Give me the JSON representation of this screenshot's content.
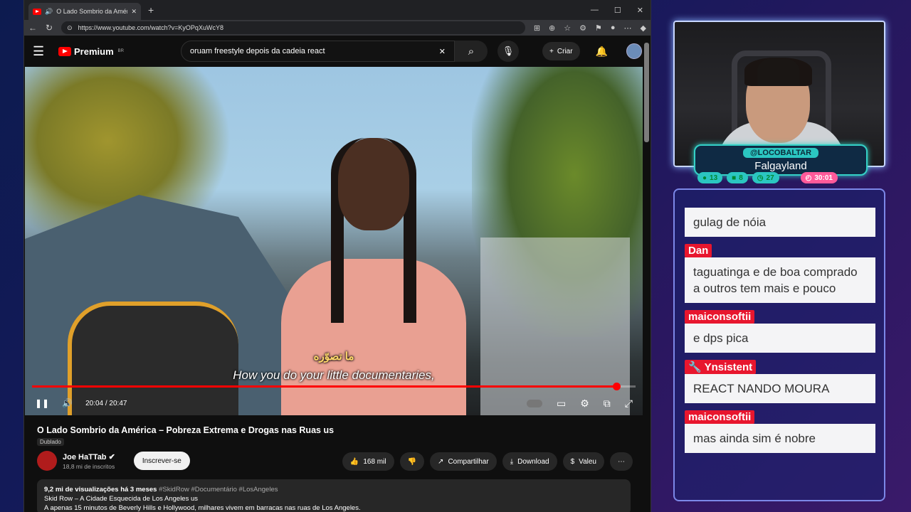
{
  "browser": {
    "tab_title": "O Lado Sombrio da Américа",
    "url": "https://www.youtube.com/watch?v=KyOPqXuWcY8",
    "win_min": "—",
    "win_max": "☐",
    "win_close": "✕"
  },
  "youtube": {
    "logo_text": "Premium",
    "logo_region": "BR",
    "search_query": "oruam freestyle depois da cadeia react",
    "create_label": "Criar",
    "video": {
      "subtitle_ar": "ما تصوّره",
      "subtitle_en": "How you do your little documentaries,",
      "time": "20:04 / 20:47",
      "progress": 0.968
    },
    "title": "O Lado Sombrio da América – Pobreza Extrema e Drogas nas Ruas us",
    "dubbed": "Dublado",
    "channel_name": "Joe HaTTab",
    "channel_subs": "18,8 mi de inscritos",
    "subscribe_label": "Inscrever-se",
    "likes": "168 mil",
    "share_label": "Compartilhar",
    "download_label": "Download",
    "thanks_label": "Valeu",
    "desc": {
      "views": "9,2 mi de visualizações",
      "age": "há 3 meses",
      "tags": "#SkidRow #Documentário #LosAngeles",
      "line1": "Skid Row – A Cidade Esquecida de Los Angeles us",
      "line2": "A apenas 15 minutos de Beverly Hills e Hollywood, milhares vivem em barracas nas ruas de Los Angeles."
    }
  },
  "overlay": {
    "handle": "@LOCOBALTAR",
    "game": "Falgayland",
    "stats": [
      "13",
      "8",
      "27"
    ],
    "timer": "30:01"
  },
  "chat": [
    {
      "user": "",
      "text": "gulag de nóia"
    },
    {
      "user": "Dan",
      "text": "taguatinga e de boa comprado a outros tem mais e pouco"
    },
    {
      "user": "maiconsoftii",
      "text": "e dps pica"
    },
    {
      "user": "Ynsistent",
      "text": "REACT NANDO MOURA"
    },
    {
      "user": "maiconsoftii",
      "text": "mas ainda sim é nobre"
    }
  ]
}
